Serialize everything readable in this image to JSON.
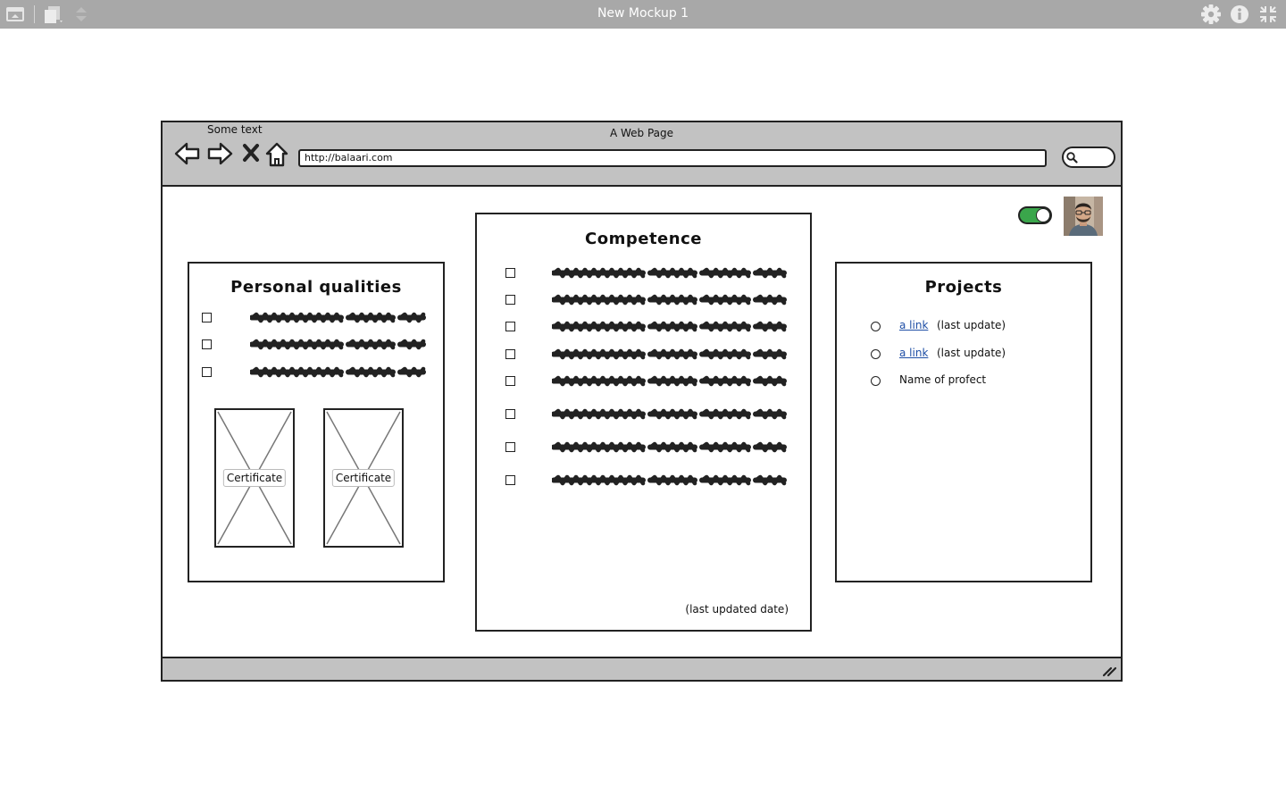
{
  "app": {
    "title": "New Mockup 1",
    "icons": [
      "app-window-icon",
      "pages-icon",
      "sort-arrows-icon",
      "settings-gear-icon",
      "info-icon",
      "collapse-fullscreen-icon"
    ]
  },
  "browser": {
    "label": "Some text",
    "page_title": "A Web Page",
    "url": "http://balaari.com"
  },
  "personal_qualities": {
    "title": "Personal qualities",
    "items_count": 3,
    "certificates": [
      "Certificate",
      "Certificate"
    ]
  },
  "competence": {
    "title": "Competence",
    "items_count": 8,
    "footer": "(last updated date)"
  },
  "projects": {
    "title": "Projects",
    "items": [
      {
        "link": "a link",
        "note": "(last update)"
      },
      {
        "link": "a link",
        "note": "(last update)"
      },
      {
        "name": "Name of profect"
      }
    ]
  },
  "header_controls": {
    "toggle_on": true
  },
  "colors": {
    "appbar": "#a8a8a8",
    "chrome": "#c2c2c2",
    "toggle": "#3aa64b",
    "link": "#1f4fa6"
  }
}
